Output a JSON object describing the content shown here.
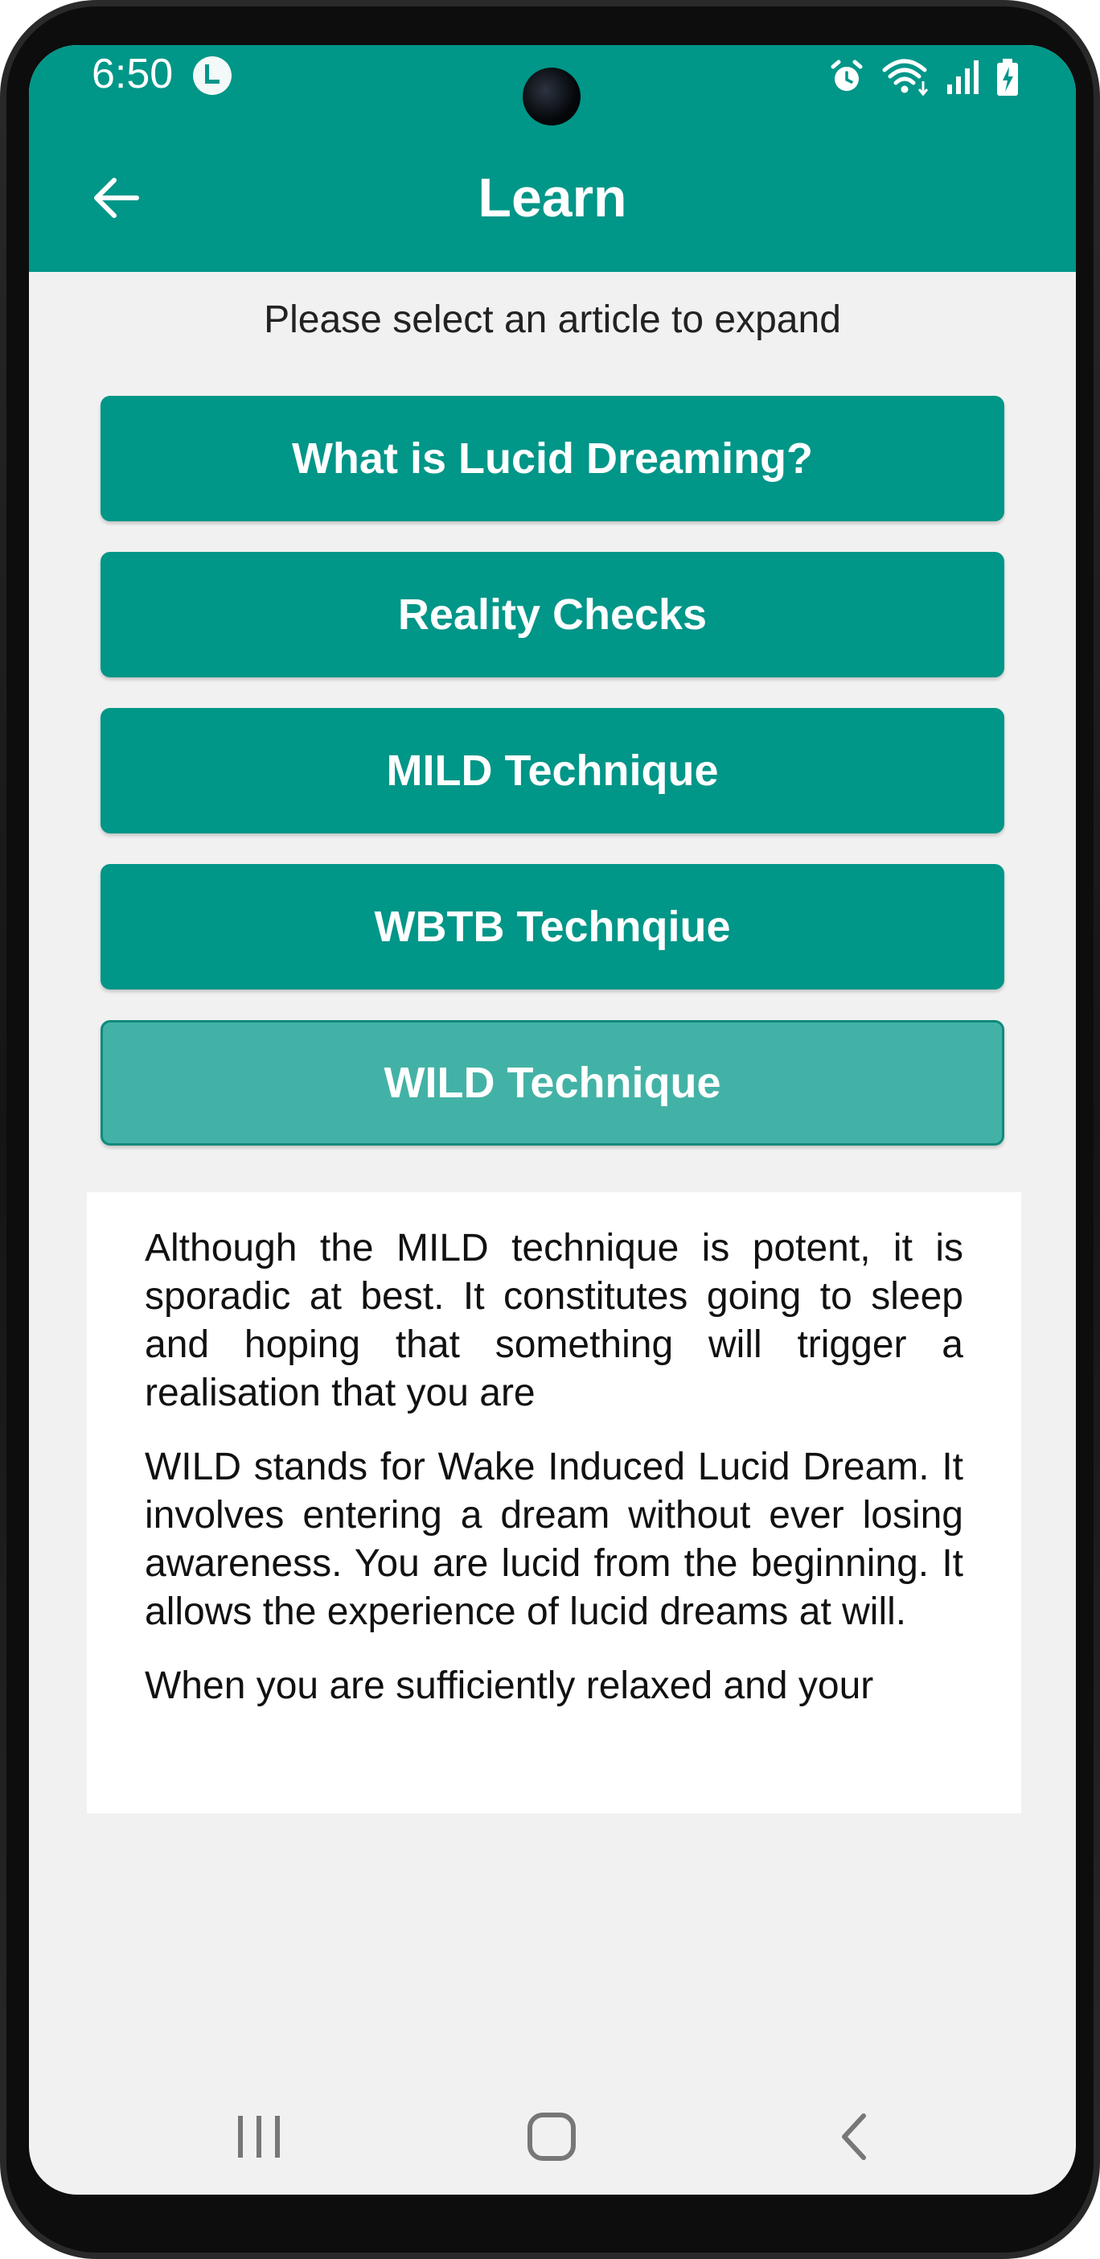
{
  "status_bar": {
    "time": "6:50",
    "icons": [
      "clock-app-icon",
      "alarm-icon",
      "wifi-icon",
      "signal-icon",
      "battery-charging-icon"
    ]
  },
  "app_bar": {
    "title": "Learn",
    "back_icon": "arrow-left-icon"
  },
  "colors": {
    "primary": "#009688",
    "primary_selected": "#43b2a6",
    "screen_background": "#f1f1f1",
    "card_background": "#ffffff"
  },
  "main": {
    "instruction": "Please select an article to expand",
    "articles": [
      {
        "label": "What is Lucid Dreaming?",
        "selected": false
      },
      {
        "label": "Reality Checks",
        "selected": false
      },
      {
        "label": "MILD Technique",
        "selected": false
      },
      {
        "label": "WBTB Technqiue",
        "selected": false
      },
      {
        "label": "WILD Technique",
        "selected": true
      }
    ],
    "content_paragraphs": [
      "Although the MILD technique is potent, it is sporadic at best. It constitutes going to sleep and hoping that something will trigger a realisation that you are",
      "WILD stands for Wake Induced Lucid Dream. It involves entering a dream without ever losing awareness. You are lucid from the beginning. It allows the experience of lucid dreams at will.",
      "When you are sufficiently relaxed and your"
    ]
  },
  "nav_bar": {
    "icons": [
      "recent-apps-icon",
      "home-icon",
      "back-icon"
    ]
  }
}
